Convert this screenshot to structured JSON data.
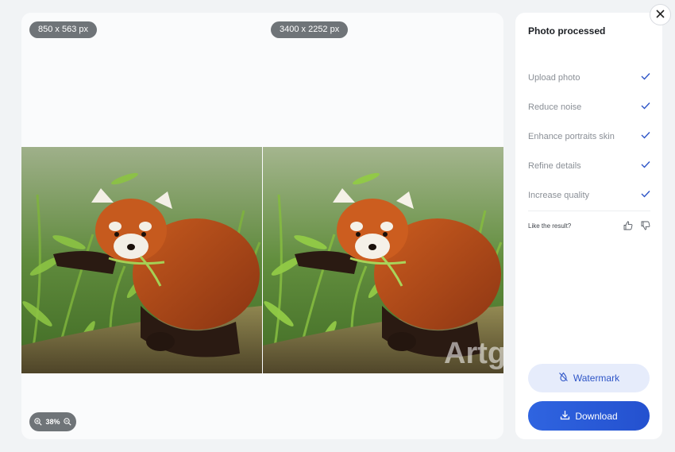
{
  "preview": {
    "original_size": "850 x 563 px",
    "processed_size": "3400 x 2252 px",
    "zoom_level": "38%",
    "watermark_text": "Artg"
  },
  "panel": {
    "title": "Photo processed",
    "steps": [
      {
        "label": "Upload photo",
        "done": true
      },
      {
        "label": "Reduce noise",
        "done": true
      },
      {
        "label": "Enhance portraits skin",
        "done": true
      },
      {
        "label": "Refine details",
        "done": true
      },
      {
        "label": "Increase quality",
        "done": true
      }
    ],
    "feedback_label": "Like the result?",
    "watermark_button": "Watermark",
    "download_button": "Download"
  },
  "colors": {
    "accent": "#2f64e0",
    "check": "#2e55c7",
    "pill": "#6f7478"
  }
}
